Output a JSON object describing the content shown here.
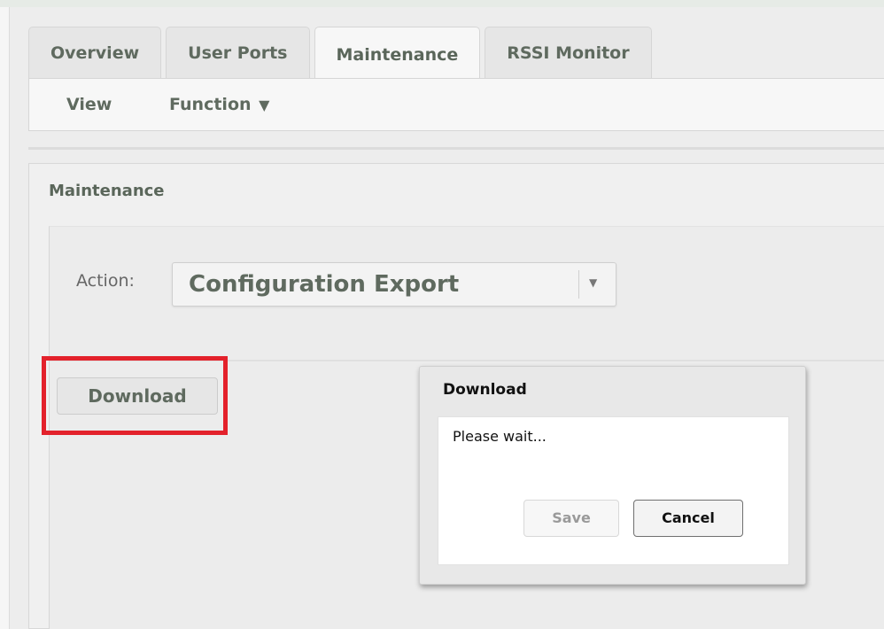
{
  "tabs": [
    {
      "label": "Overview",
      "active": false
    },
    {
      "label": "User Ports",
      "active": false
    },
    {
      "label": "Maintenance",
      "active": true
    },
    {
      "label": "RSSI Monitor",
      "active": false
    }
  ],
  "subnav": {
    "view_label": "View",
    "function_label": "Function",
    "function_arrow": "▼"
  },
  "panel": {
    "title": "Maintenance",
    "action_label": "Action:",
    "action_value": "Configuration Export",
    "select_arrow": "▼",
    "download_label": "Download"
  },
  "dialog": {
    "title": "Download",
    "message": "Please wait...",
    "save_label": "Save",
    "cancel_label": "Cancel"
  },
  "colors": {
    "highlight": "#e3212b",
    "tab_text": "#5f6a5f"
  }
}
